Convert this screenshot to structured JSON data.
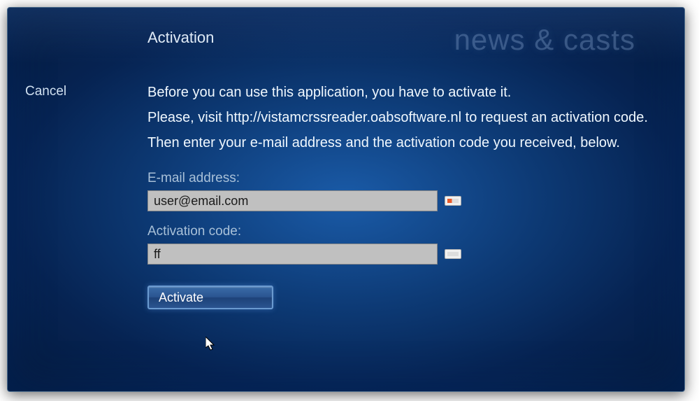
{
  "header": {
    "title": "Activation",
    "brand": "news & casts"
  },
  "sidebar": {
    "cancel": "Cancel"
  },
  "instructions": {
    "line1": "Before you can use this application, you have to activate it.",
    "line2": "Please, visit http://vistamcrssreader.oabsoftware.nl to request an activation code.",
    "line3": "Then enter your e-mail address and the activation code you received, below."
  },
  "form": {
    "email_label": "E-mail address:",
    "email_value": "user@email.com",
    "code_label": "Activation code:",
    "code_value": "ff",
    "activate_label": "Activate"
  }
}
